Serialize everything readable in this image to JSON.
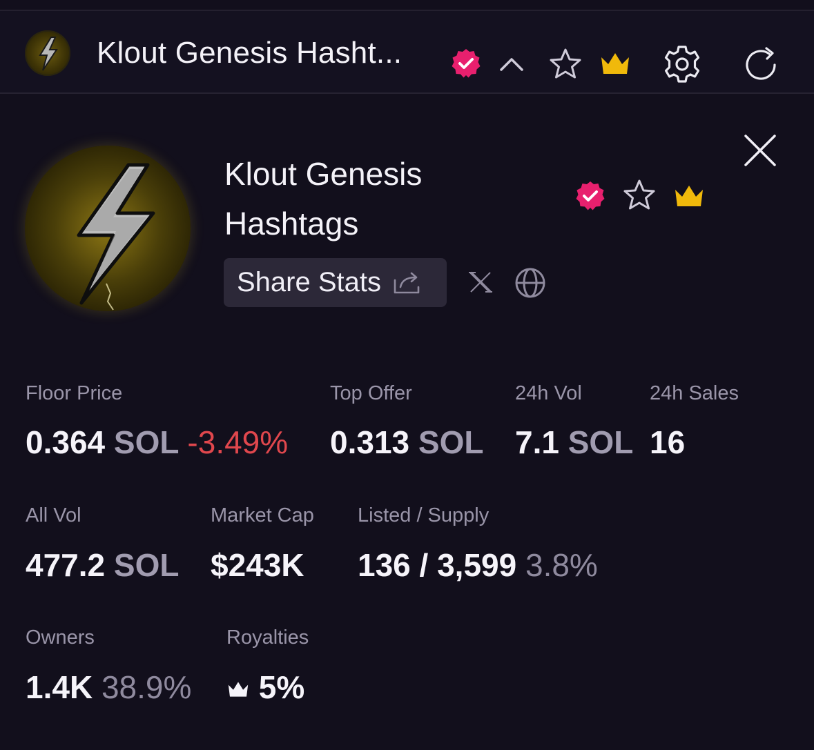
{
  "header": {
    "title": "Klout Genesis Hasht...",
    "colors": {
      "verified": "#e8206e",
      "crown": "#f0b90b",
      "icon": "#f2f0f7",
      "icon_muted": "#8f8a9e"
    }
  },
  "collection": {
    "name_line1": "Klout Genesis",
    "name_line2": "Hashtags",
    "share_label": "Share Stats"
  },
  "stats": {
    "floor_price": {
      "label": "Floor Price",
      "value": "0.364",
      "unit": "SOL",
      "change": "-3.49%"
    },
    "top_offer": {
      "label": "Top Offer",
      "value": "0.313",
      "unit": "SOL"
    },
    "vol_24h": {
      "label": "24h Vol",
      "value": "7.1",
      "unit": "SOL"
    },
    "sales_24h": {
      "label": "24h Sales",
      "value": "16"
    },
    "all_vol": {
      "label": "All Vol",
      "value": "477.2",
      "unit": "SOL"
    },
    "market_cap": {
      "label": "Market Cap",
      "value": "$243K"
    },
    "listed_supply": {
      "label": "Listed / Supply",
      "value": "136 / 3,599",
      "pct": "3.8%"
    },
    "owners": {
      "label": "Owners",
      "value": "1.4K",
      "pct": "38.9%"
    },
    "royalties": {
      "label": "Royalties",
      "value": "5%"
    }
  },
  "icons": [
    "lightning-logo",
    "verified-icon",
    "chevron-up-icon",
    "star-icon",
    "crown-icon",
    "gear-icon",
    "refresh-icon",
    "close-icon",
    "share-icon",
    "x-logo-icon",
    "globe-icon"
  ]
}
